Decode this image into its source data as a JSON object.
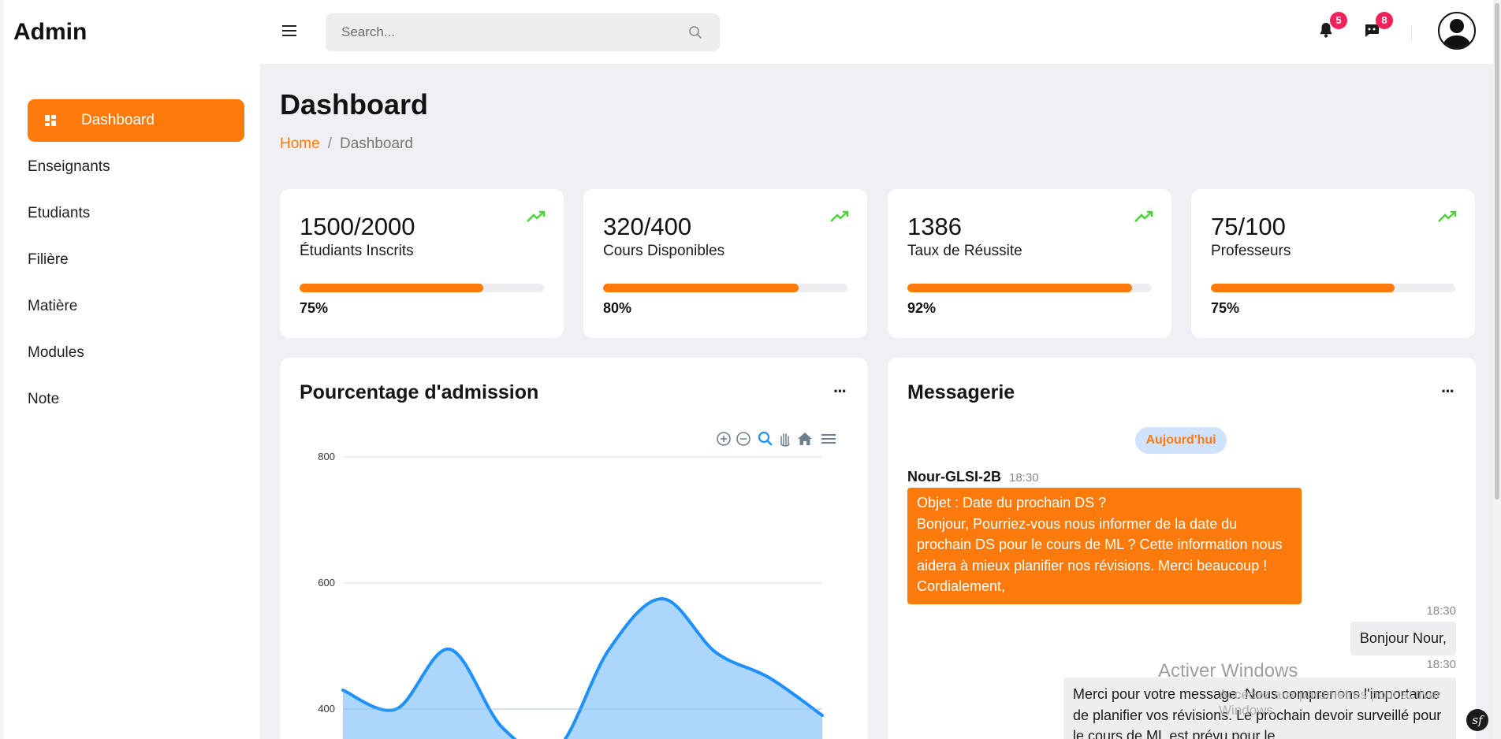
{
  "app": {
    "brand": "Admin"
  },
  "sidebar": {
    "items": [
      {
        "label": "Dashboard"
      },
      {
        "label": "Enseignants"
      },
      {
        "label": "Etudiants"
      },
      {
        "label": "Filière"
      },
      {
        "label": "Matière"
      },
      {
        "label": "Modules"
      },
      {
        "label": "Note"
      }
    ]
  },
  "header": {
    "search_placeholder": "Search...",
    "notifications": {
      "count": "5",
      "icon": "bell-icon"
    },
    "messages": {
      "count": "8",
      "icon": "chat-icon"
    }
  },
  "page": {
    "title": "Dashboard",
    "breadcrumb": {
      "home": "Home",
      "separator": "/",
      "current": "Dashboard"
    }
  },
  "stats": [
    {
      "value": "1500/2000",
      "label": "Étudiants Inscrits",
      "percent": "75%",
      "progress": 0.75
    },
    {
      "value": "320/400",
      "label": "Cours Disponibles",
      "percent": "80%",
      "progress": 0.8
    },
    {
      "value": "1386",
      "label": "Taux de Réussite",
      "percent": "92%",
      "progress": 0.92
    },
    {
      "value": "75/100",
      "label": "Professeurs",
      "percent": "75%",
      "progress": 0.75
    }
  ],
  "chart_card": {
    "title": "Pourcentage d'admission",
    "menu": "···",
    "toolbar": [
      "zoom-in-icon",
      "zoom-out-icon",
      "selection-zoom-icon",
      "pan-hand-icon",
      "home-icon",
      "menu-icon"
    ]
  },
  "chart_data": {
    "type": "area",
    "yticks": [
      "800",
      "600",
      "400"
    ],
    "ylim": [
      200,
      800
    ],
    "series": [
      {
        "values": [
          430,
          400,
          495,
          370,
          335,
          495,
          575,
          490,
          450,
          390
        ]
      }
    ],
    "color": "#1e90ff",
    "fill": "#a8d4fb"
  },
  "messages_card": {
    "title": "Messagerie",
    "menu": "···",
    "day_pill": "Aujourd'hui",
    "incoming": {
      "sender": "Nour-GLSI-2B",
      "time": "18:30",
      "text": "Objet : Date du prochain DS ?\nBonjour, Pourriez-vous nous informer de la date du prochain DS pour le cours de ML ? Cette information nous aidera à mieux planifier nos révisions. Merci beaucoup !\nCordialement,"
    },
    "outgoing": [
      {
        "time": "18:30",
        "text": "Bonjour Nour,"
      },
      {
        "time": "18:30",
        "text": "Merci pour votre message. Nous comprenons l'importance de planifier vos révisions. Le prochain devoir surveillé pour le cours de ML est prévu pour le"
      }
    ]
  },
  "overlay": {
    "watermark": "Activer Windows",
    "watermark_sub": "Accédez aux paramètres pour activer Windows.",
    "corner_badge": "sf"
  },
  "colors": {
    "accent": "#fe7b0b",
    "badge": "#f3215a",
    "trend": "#4cd137",
    "chart_line": "#1e90ff"
  }
}
